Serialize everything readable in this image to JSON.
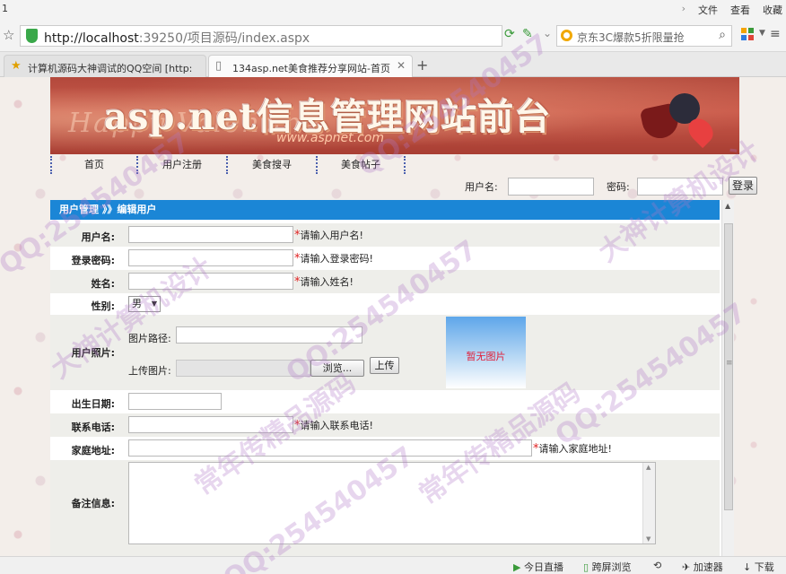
{
  "browser": {
    "title_num": "1",
    "menu": [
      "文件",
      "查看",
      "收藏"
    ],
    "address_host": "http://localhost",
    "address_rest": ":39250/项目源码/index.aspx",
    "search_placeholder": "京东3C爆款5折限量抢",
    "tabs": [
      {
        "label": "计算机源码大神调试的QQ空间 [http:",
        "icon": "star-icon"
      },
      {
        "label": "134asp.net美食推荐分享网站-首页",
        "icon": "page-icon"
      }
    ]
  },
  "site": {
    "banner_title": "asp.net信息管理网站前台",
    "banner_sub": "www.aspnet.com",
    "banner_script": "Happy Valentine",
    "nav": [
      "首页",
      "用户注册",
      "美食搜寻",
      "美食帖子"
    ],
    "login": {
      "username_label": "用户名:",
      "password_label": "密码:",
      "button": "登录"
    }
  },
  "form": {
    "header": "用户管理 》》编辑用户",
    "fields": {
      "username": {
        "label": "用户名:",
        "hint": "请输入用户名!"
      },
      "password": {
        "label": "登录密码:",
        "hint": "请输入登录密码!"
      },
      "name": {
        "label": "姓名:",
        "hint": "请输入姓名!"
      },
      "gender": {
        "label": "性别:",
        "value": "男"
      },
      "photo": {
        "label": "用户照片:",
        "path_label": "图片路径:",
        "upload_label": "上传图片:",
        "browse_button": "浏览...",
        "upload_button": "上传",
        "placeholder": "暂无图片"
      },
      "birthdate": {
        "label": "出生日期:"
      },
      "phone": {
        "label": "联系电话:",
        "hint": "请输入联系电话!"
      },
      "address": {
        "label": "家庭地址:",
        "hint": "请输入家庭地址!"
      },
      "notes": {
        "label": "备注信息:"
      }
    }
  },
  "statusbar": [
    "今日直播",
    "跨屏浏览",
    "加速器",
    "下载"
  ],
  "watermarks": [
    "QQ:254540457",
    "大神计算机设计",
    "常年传精品源码"
  ],
  "colors": {
    "section_header": "#1b86d6",
    "required": "#e02020",
    "photo_placeholder": "#e0203a"
  }
}
